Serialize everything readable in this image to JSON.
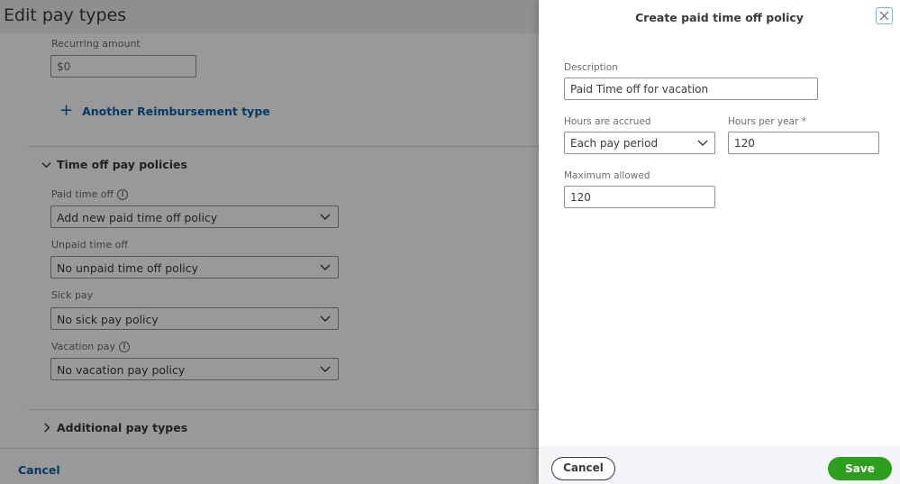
{
  "background_page": {
    "title": "Edit pay types",
    "recurring_amount": {
      "label": "Recurring amount",
      "value": "$0"
    },
    "add_reimbursement_link": {
      "icon": "plus-icon",
      "label": "Another Reimbursement type"
    },
    "time_off_section": {
      "title": "Time off pay policies",
      "expanded": true,
      "fields": [
        {
          "label": "Paid time off",
          "has_info_icon": true,
          "value": "Add new paid time off policy"
        },
        {
          "label": "Unpaid time off",
          "has_info_icon": false,
          "value": "No unpaid time off policy"
        },
        {
          "label": "Sick pay",
          "has_info_icon": false,
          "value": "No sick pay policy"
        },
        {
          "label": "Vacation pay",
          "has_info_icon": true,
          "value": "No vacation pay policy"
        }
      ]
    },
    "additional_section": {
      "title": "Additional pay types",
      "expanded": false
    },
    "footer": {
      "cancel_label": "Cancel"
    }
  },
  "panel": {
    "title": "Create paid time off policy",
    "close_icon": "close-icon",
    "description": {
      "label": "Description",
      "value": "Paid Time off for vacation"
    },
    "hours_accrued": {
      "label": "Hours are accrued",
      "value": "Each pay period"
    },
    "hours_per_year": {
      "label": "Hours per year *",
      "value": "120"
    },
    "maximum_allowed": {
      "label": "Maximum allowed",
      "value": "120"
    },
    "footer": {
      "cancel_label": "Cancel",
      "save_label": "Save"
    }
  },
  "colors": {
    "link": "#0d5fa6",
    "save_green": "#2ca01c",
    "close_border": "#79b4e6",
    "panel_footer_bg": "#f4f5f8"
  }
}
